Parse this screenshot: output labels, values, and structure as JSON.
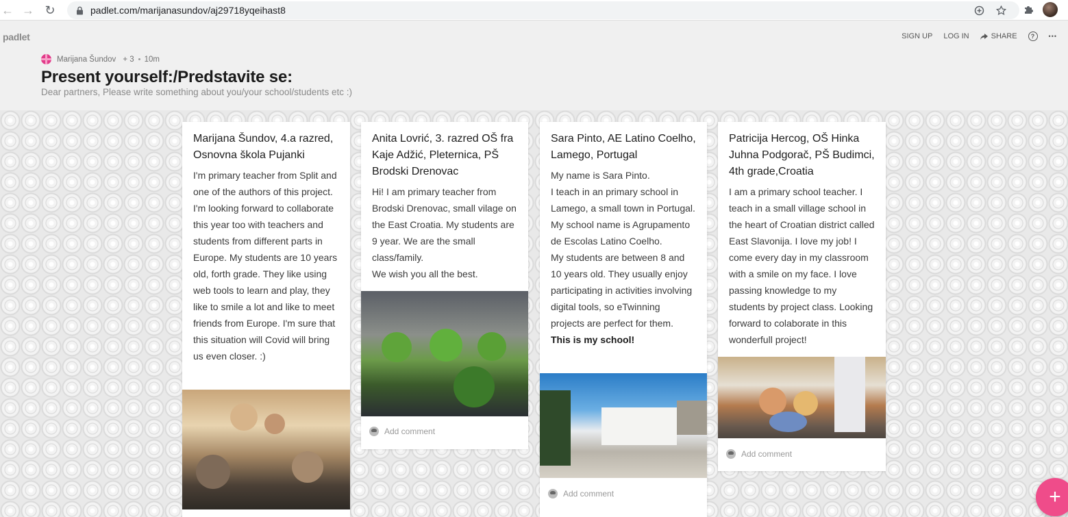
{
  "browser": {
    "url": "padlet.com/marijanasundov/aj29718yqeihast8"
  },
  "header": {
    "brand": "padlet",
    "sign_up": "SIGN UP",
    "log_in": "LOG IN",
    "share": "SHARE",
    "help": "?",
    "more": "•••",
    "author": "Marijana Šundov",
    "contributors": "+ 3",
    "age": "10m",
    "title": "Present yourself:/Predstavite se:",
    "description": "Dear partners, Please write something about you/your school/students etc :)"
  },
  "posts": [
    {
      "title": "Marijana Šundov, 4.a razred, Osnovna škola Pujanki",
      "body": [
        "I'm primary teacher from Split and one of the authors of this project. I'm looking forward to collaborate this year too with teachers and students from different parts in Europe. My students are 10 years old, forth grade. They like using web tools to learn and play, they like to smile a lot and like to meet friends from Europe. I'm sure that this situation will Covid will bring us even closer. :)"
      ],
      "bold": ""
    },
    {
      "title": "Anita Lovrić, 3. razred OŠ fra Kaje Adžić, Pleternica, PŠ Brodski Drenovac",
      "body": [
        "Hi! I am primary teacher from Brodski  Drenovac, small vilage on the East Croatia. My students are 9 year. We are the small class/family.",
        "We wish you all the best."
      ],
      "bold": "",
      "comment": "Add comment"
    },
    {
      "title": "Sara Pinto, AE Latino Coelho, Lamego, Portugal",
      "body": [
        "My name is Sara Pinto.",
        "I teach in an primary school in Lamego, a small town in Portugal.",
        "My school name is Agrupamento de Escolas Latino Coelho.",
        "My students are between 8 and 10 years old. They usually enjoy participating in activities involving digital tools, so eTwinning projects are perfect for them."
      ],
      "bold": "This is my school!",
      "comment": "Add comment"
    },
    {
      "title": "Patricija Hercog, OŠ Hinka Juhna Podgorač, PŠ Budimci, 4th grade,Croatia",
      "body": [
        "I am a primary school teacher. I teach in a small village school in the heart of Croatian district called East Slavonija. I love my job! I come every day in my classroom with a smile on my face. I love passing knowledge to my students by project class. Looking forward to colaborate in this wonderfull project!"
      ],
      "bold": "",
      "comment": "Add comment"
    }
  ],
  "fab": "+",
  "colors": {
    "accent": "#ef4c8a",
    "author_avatar": "#e23b8a"
  }
}
